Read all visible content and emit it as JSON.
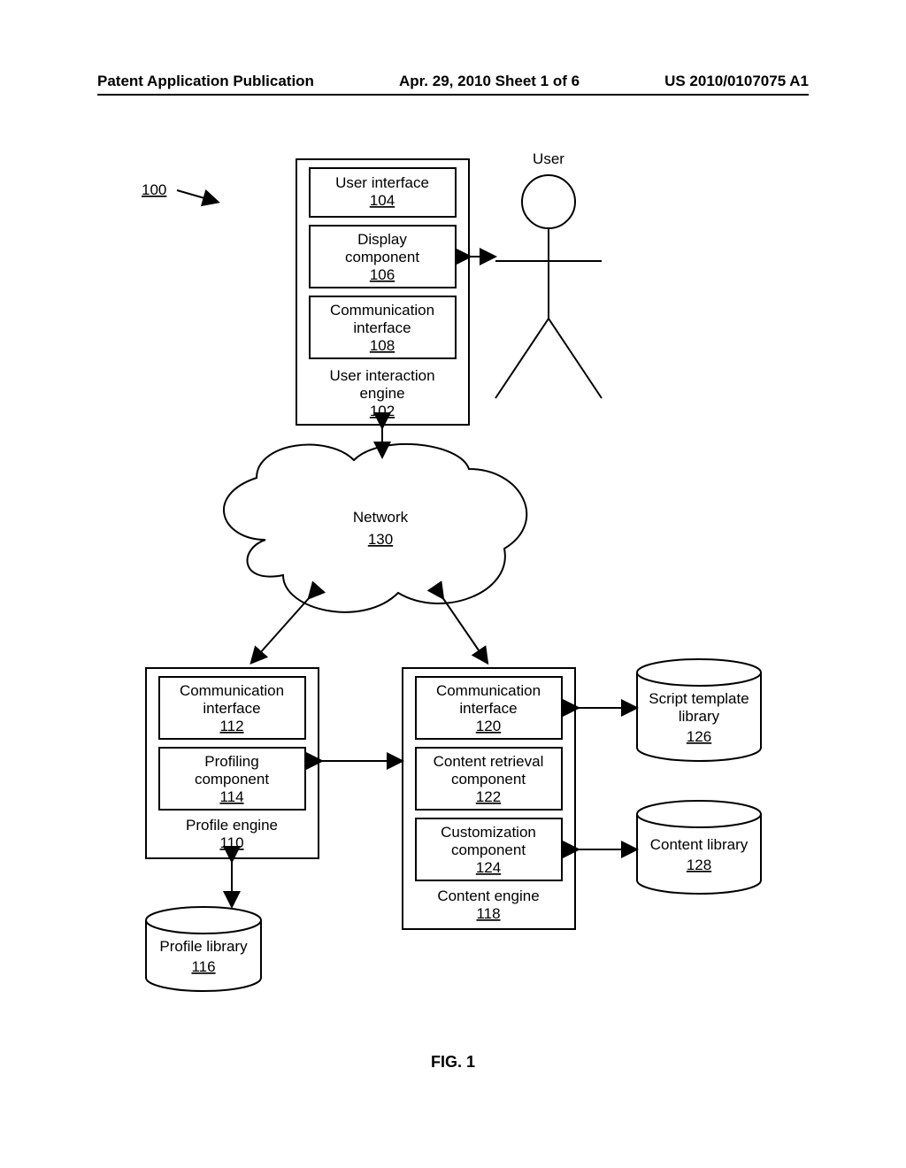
{
  "header": {
    "left": "Patent Application Publication",
    "center": "Apr. 29, 2010  Sheet 1 of 6",
    "right": "US 2010/0107075 A1"
  },
  "figure": {
    "label": "FIG. 1",
    "ref": "100",
    "user_label": "User",
    "user_interaction_engine": {
      "title": "User interaction engine",
      "num": "102",
      "ui": {
        "title": "User interface",
        "num": "104"
      },
      "display": {
        "title": "Display component",
        "num": "106"
      },
      "comm": {
        "title": "Communication interface",
        "num": "108"
      }
    },
    "network": {
      "title": "Network",
      "num": "130"
    },
    "profile_engine": {
      "title": "Profile engine",
      "num": "110",
      "comm": {
        "title": "Communication interface",
        "num": "112"
      },
      "profiling": {
        "title": "Profiling component",
        "num": "114"
      }
    },
    "profile_library": {
      "title": "Profile library",
      "num": "116"
    },
    "content_engine": {
      "title": "Content engine",
      "num": "118",
      "comm": {
        "title": "Communication interface",
        "num": "120"
      },
      "retrieval": {
        "title": "Content retrieval component",
        "num": "122"
      },
      "custom": {
        "title": "Customization component",
        "num": "124"
      }
    },
    "script_library": {
      "title": "Script template library",
      "num": "126"
    },
    "content_library": {
      "title": "Content library",
      "num": "128"
    }
  }
}
